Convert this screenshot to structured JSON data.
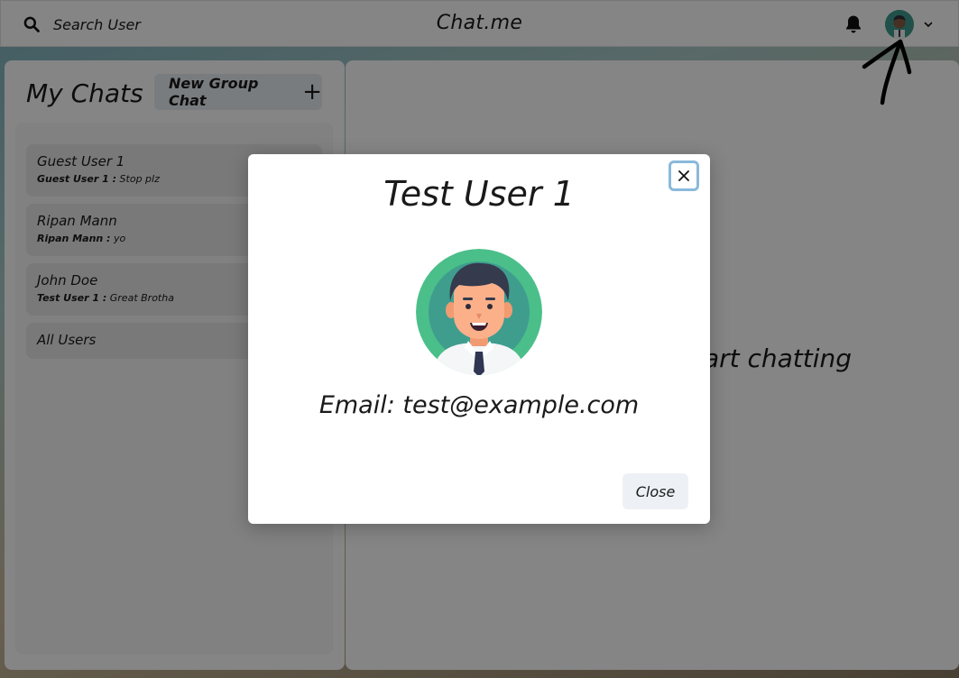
{
  "header": {
    "search_label": "Search User",
    "app_title": "Chat.me",
    "icons": [
      "search-icon",
      "bell-icon",
      "avatar",
      "chevron-down-icon"
    ]
  },
  "sidebar": {
    "title": "My Chats",
    "new_group_label": "New Group Chat",
    "new_group_icon": "+",
    "chats": [
      {
        "name": "Guest User 1",
        "sender": "Guest User 1 :",
        "message": "Stop plz"
      },
      {
        "name": "Ripan Mann",
        "sender": "Ripan Mann :",
        "message": "yo"
      },
      {
        "name": "John Doe",
        "sender": "Test User 1 :",
        "message": "Great Brotha"
      },
      {
        "name": "All Users",
        "sender": "",
        "message": ""
      }
    ]
  },
  "main": {
    "placeholder": "Click on a user to start chatting"
  },
  "modal": {
    "title": "Test User 1",
    "email": "Email: test@example.com",
    "close_label": "Close",
    "close_icon": "close-icon"
  },
  "colors": {
    "avatar_bg": "#4bbf8a",
    "close_focus_ring": "#8ab9dc",
    "button_bg": "#e9eef3",
    "overlay": "rgba(0,0,0,0.48)"
  }
}
